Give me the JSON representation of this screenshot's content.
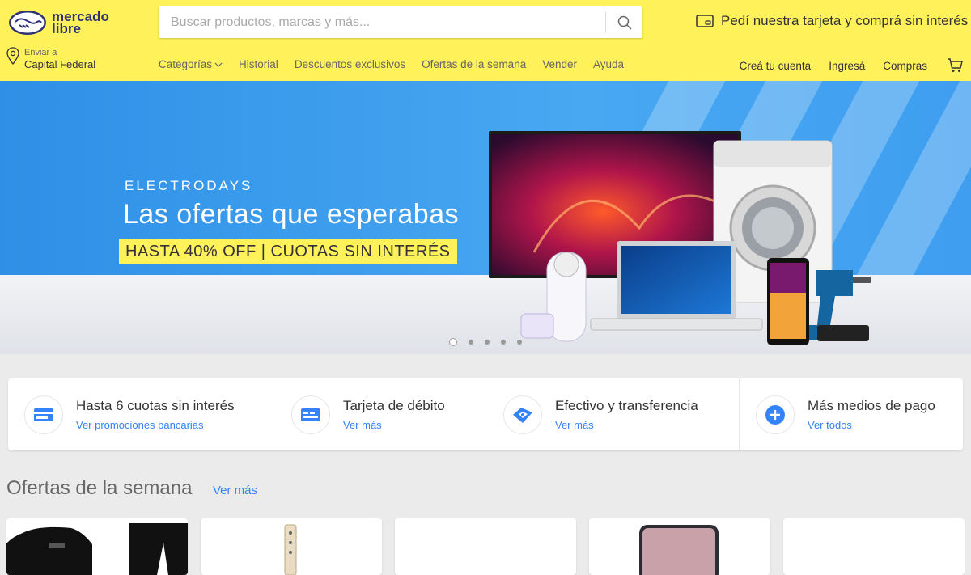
{
  "brand": {
    "line1": "mercado",
    "line2": "libre"
  },
  "search": {
    "placeholder": "Buscar productos, marcas y más..."
  },
  "promo": {
    "text": "Pedí nuestra tarjeta y comprá sin interés"
  },
  "location": {
    "label": "Enviar a",
    "value": "Capital Federal"
  },
  "nav": {
    "categories": "Categorías",
    "history": "Historial",
    "discounts": "Descuentos exclusivos",
    "weekly": "Ofertas de la semana",
    "sell": "Vender",
    "help": "Ayuda"
  },
  "account": {
    "create": "Creá tu cuenta",
    "login": "Ingresá",
    "purchases": "Compras"
  },
  "banner": {
    "eyebrow": "ELECTRODAYS",
    "title": "Las ofertas que esperabas",
    "tag": "HASTA 40% OFF | CUOTAS SIN INTERÉS",
    "slides_total": 5,
    "active_slide": 1
  },
  "payments": [
    {
      "title": "Hasta 6 cuotas sin interés",
      "link": "Ver promociones bancarias",
      "icon": "credit-card-icon"
    },
    {
      "title": "Tarjeta de débito",
      "link": "Ver más",
      "icon": "debit-card-icon"
    },
    {
      "title": "Efectivo y transferencia",
      "link": "Ver más",
      "icon": "cash-transfer-icon"
    },
    {
      "title": "Más medios de pago",
      "link": "Ver todos",
      "icon": "plus-icon"
    }
  ],
  "offers": {
    "title": "Ofertas de la semana",
    "link": "Ver más"
  },
  "colors": {
    "brand_yellow": "#fff159",
    "brand_blue": "#2d3277",
    "link_blue": "#3483fa"
  }
}
